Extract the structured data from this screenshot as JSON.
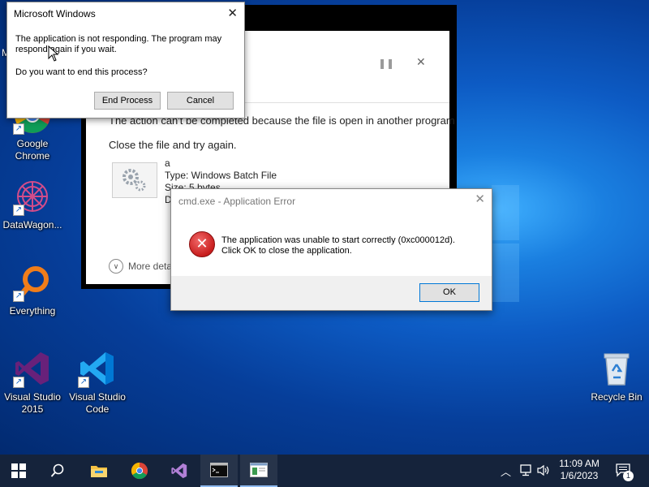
{
  "desktop": {
    "icons": [
      {
        "label": "Google Chrome"
      },
      {
        "label": "DataWagon..."
      },
      {
        "label": "Everything"
      },
      {
        "label": "Visual Studio 2015"
      },
      {
        "label": "Visual Studio Code"
      },
      {
        "label": "Recycle Bin"
      }
    ],
    "partial_label": "M"
  },
  "file_in_use_dialog": {
    "message": "The action can't be completed because the file is open in another program",
    "instruction": "Close the file and try again.",
    "file_name": "a",
    "file_type": "Type: Windows Batch File",
    "file_size": "Size: 5 bytes",
    "file_date_partial": "D",
    "more_details": "More deta"
  },
  "ms_windows_dialog": {
    "title": "Microsoft Windows",
    "message": "The application is not responding. The program may respond again if you wait.",
    "question": "Do you want to end this process?",
    "end_process_label": "End Process",
    "cancel_label": "Cancel"
  },
  "app_error_dialog": {
    "title": "cmd.exe - Application Error",
    "line1": "The application was unable to start correctly (0xc000012d).",
    "line2": "Click OK to close the application.",
    "ok_label": "OK"
  },
  "taskbar": {
    "time": "11:09 AM",
    "date": "1/6/2023",
    "notification_count": "1"
  },
  "colors": {
    "accent": "#0078d7",
    "error_red": "#c81e1e",
    "taskbar": "#15233b"
  }
}
